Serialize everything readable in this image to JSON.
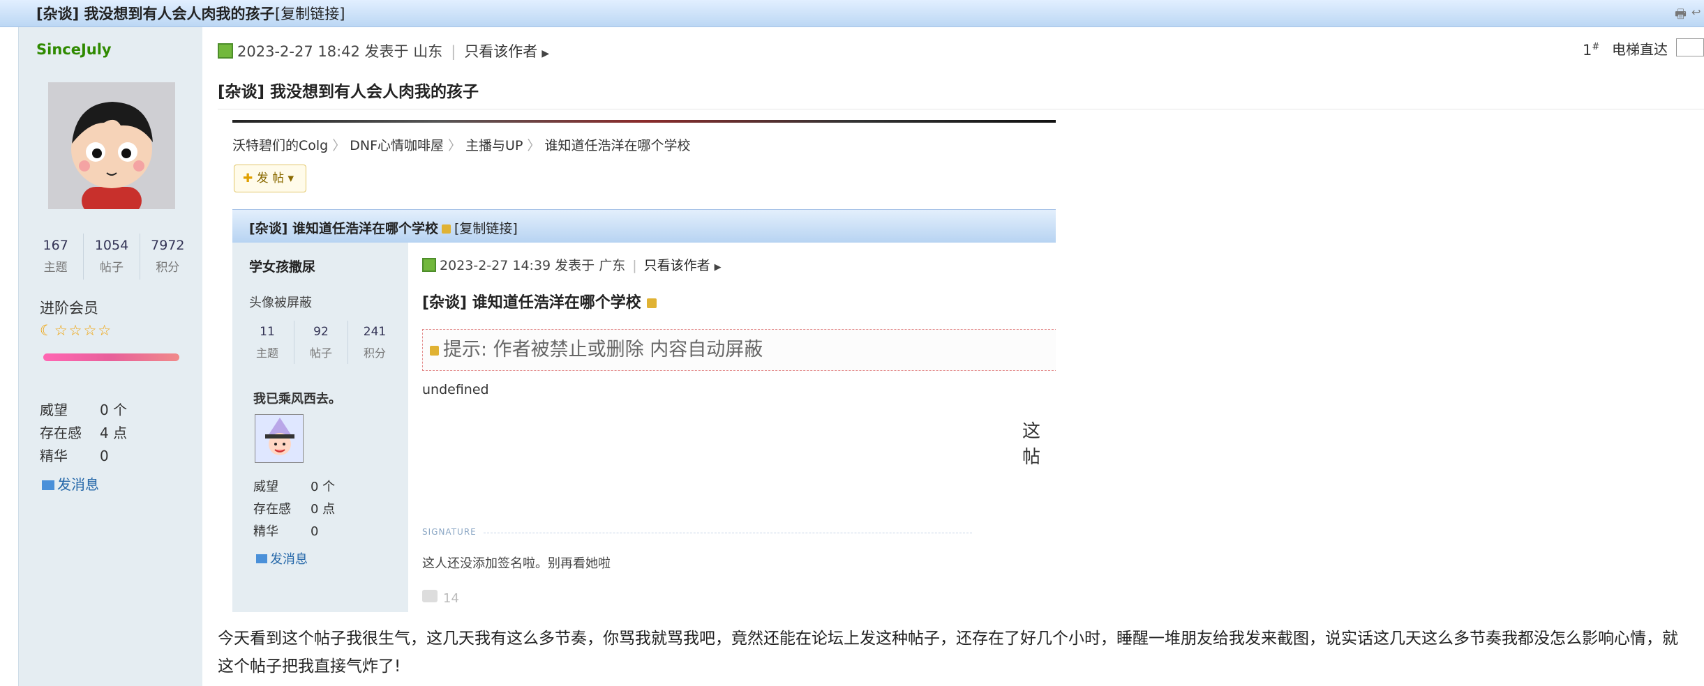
{
  "topbar": {
    "title": "[杂谈] 我没想到有人会人肉我的孩子",
    "copy_link": "[复制链接]"
  },
  "sidebar": {
    "username": "SinceJuly",
    "stats": [
      {
        "value": "167",
        "label": "主题"
      },
      {
        "value": "1054",
        "label": "帖子"
      },
      {
        "value": "7972",
        "label": "积分"
      }
    ],
    "group": "进阶会员",
    "rows": [
      {
        "key": "威望",
        "value": "0 个"
      },
      {
        "key": "存在感",
        "value": "4 点"
      },
      {
        "key": "精华",
        "value": "0"
      }
    ],
    "send_message": "发消息"
  },
  "post": {
    "meta_date": "2023-2-27 18:42 发表于 山东",
    "only_author": "只看该作者",
    "floor": "1",
    "floor_sup": "#",
    "jump_label": "电梯直达",
    "title": "[杂谈] 我没想到有人会人肉我的孩子",
    "body": "今天看到这个帖子我很生气，这几天我有这么多节奏，你骂我就骂我吧，竟然还能在论坛上发这种帖子，还存在了好几个小时，睡醒一堆朋友给我发来截图，说实话这几天这么多节奏我都没怎么影响心情，就这个帖子把我直接气炸了!"
  },
  "screenshot": {
    "breadcrumbs": [
      "沃特碧们的Colg",
      "DNF心情咖啡屋",
      "主播与UP",
      "谁知道任浩洋在哪个学校"
    ],
    "post_button": "发 帖",
    "bar_title": "[杂谈] 谁知道任浩洋在哪个学校",
    "bar_copy": "[复制链接]",
    "username": "学女孩撒尿",
    "avatar_hidden": "头像被屏蔽",
    "stats": [
      {
        "value": "11",
        "label": "主题"
      },
      {
        "value": "92",
        "label": "帖子"
      },
      {
        "value": "241",
        "label": "积分"
      }
    ],
    "gone_text": "我已乘风西去。",
    "rows": [
      {
        "key": "威望",
        "value": "0 个"
      },
      {
        "key": "存在感",
        "value": "0 点"
      },
      {
        "key": "精华",
        "value": "0"
      }
    ],
    "send_message": "发消息",
    "meta_date": "2023-2-27 14:39 发表于 广东",
    "only_author": "只看该作者",
    "title": "[杂谈] 谁知道任浩洋在哪个学校",
    "hint": "提示: 作者被禁止或删除 内容自动屏蔽",
    "undefined": "undefined",
    "cut_text": "这帖",
    "signature_label": "SIGNATURE",
    "signature_text": "这人还没添加签名啦。别再看她啦",
    "like_count": "14"
  },
  "colors": {
    "username_green": "#2f8a00",
    "sidebar_bg": "#e5edf2",
    "link_blue": "#2366a8"
  }
}
